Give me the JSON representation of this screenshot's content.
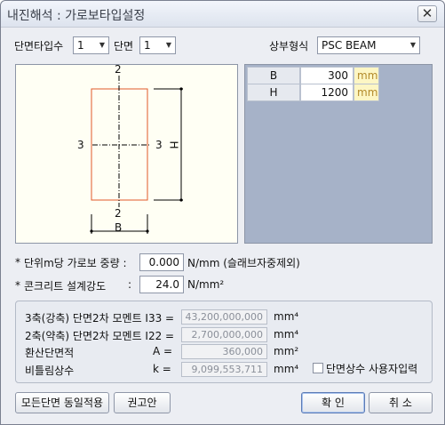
{
  "window": {
    "title": "내진해석 : 가로보타입설정",
    "close_glyph": "✕"
  },
  "top": {
    "section_type_count_label": "단면타입수",
    "section_type_count_value": "1",
    "section_label": "단면",
    "section_value": "1",
    "superstructure_label": "상부형식",
    "superstructure_value": "PSC BEAM"
  },
  "diagram": {
    "axis_top": "2",
    "axis_bottom": "2",
    "axis_left": "3",
    "axis_right": "3",
    "dim_height": "H",
    "dim_width": "B"
  },
  "dimensions": {
    "rows": [
      {
        "name": "B",
        "value": "300",
        "unit": "mm"
      },
      {
        "name": "H",
        "value": "1200",
        "unit": "mm"
      }
    ]
  },
  "params": {
    "weight_bullet": "*",
    "weight_label": "단위m당 가로보 중량 :",
    "weight_value": "0.000",
    "weight_unit": "N/mm (슬래브자중제외)",
    "strength_bullet": "*",
    "strength_label": "콘크리트 설계강도",
    "strength_colon": ":",
    "strength_value": "24.0",
    "strength_unit": "N/mm²"
  },
  "section_props": {
    "i33_label": "3축(강축) 단면2차 모멘트 I33 =",
    "i33_value": "43,200,000,000",
    "i33_unit": "mm⁴",
    "i22_label": "2축(약축) 단면2차 모멘트 I22 =",
    "i22_value": "2,700,000,000",
    "i22_unit": "mm⁴",
    "area_label": "환산단면적",
    "area_symbol": "A =",
    "area_value": "360,000",
    "area_unit": "mm²",
    "torsion_label": "비틀림상수",
    "torsion_symbol": "k =",
    "torsion_value": "9,099,553,711",
    "torsion_unit": "mm⁴",
    "user_input_label": "단면상수 사용자입력"
  },
  "buttons": {
    "apply_all": "모든단면 동일적용",
    "recommended": "권고안",
    "ok": "확 인",
    "cancel": "취 소"
  }
}
